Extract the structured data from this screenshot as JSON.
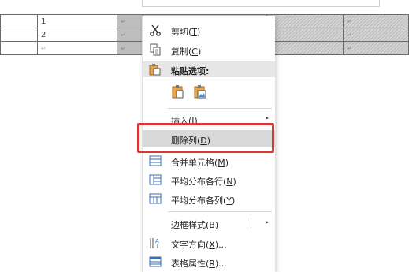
{
  "table": {
    "rows": [
      [
        "",
        "1",
        "↵",
        "",
        "↵",
        "↵"
      ],
      [
        "",
        "2",
        "↵",
        "",
        "↵",
        "↵"
      ],
      [
        "",
        "↵",
        "↵",
        "",
        "↵",
        "↵"
      ]
    ]
  },
  "context_menu": {
    "cut": {
      "label": "剪切(",
      "key": "T",
      "tail": ")",
      "icon": "scissors-icon"
    },
    "copy": {
      "label": "复制(",
      "key": "C",
      "tail": ")",
      "icon": "copy-icon"
    },
    "paste_options": {
      "label": "粘贴选项:",
      "icon": "paste-icon"
    },
    "insert": {
      "label": "插入(",
      "key": "I",
      "tail": ")",
      "arrow": "▸"
    },
    "delete_column": {
      "label": "删除列(",
      "key": "D",
      "tail": ")"
    },
    "merge_cells": {
      "label": "合并单元格(",
      "key": "M",
      "tail": ")",
      "icon": "merge-cells-icon"
    },
    "distribute_rows": {
      "label": "平均分布各行(",
      "key": "N",
      "tail": ")",
      "icon": "distribute-rows-icon"
    },
    "distribute_columns": {
      "label": "平均分布各列(",
      "key": "Y",
      "tail": ")",
      "icon": "distribute-columns-icon"
    },
    "border_styles": {
      "label": "边框样式(",
      "key": "B",
      "tail": ")",
      "arrow": "▸"
    },
    "text_direction": {
      "label": "文字方向(",
      "key": "X",
      "tail": ")...",
      "icon": "text-direction-icon"
    },
    "table_properties": {
      "label": "表格属性(",
      "key": "R",
      "tail": ")...",
      "icon": "table-properties-icon"
    }
  },
  "colors": {
    "highlight": "#d93636",
    "selection": "#bdbdbd"
  }
}
